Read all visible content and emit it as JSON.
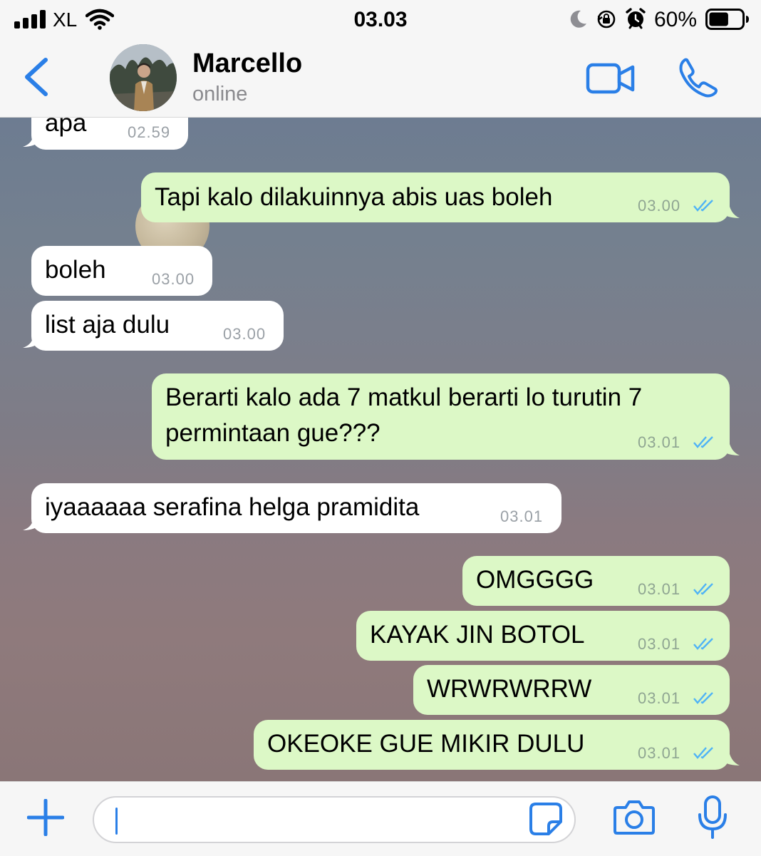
{
  "status_bar": {
    "carrier": "XL",
    "time": "03.03",
    "battery_percent": "60%",
    "battery_level": 0.6
  },
  "header": {
    "contact_name": "Marcello",
    "contact_status": "online"
  },
  "messages": [
    {
      "direction": "in",
      "text": "apa",
      "time": "02.59"
    },
    {
      "direction": "out",
      "text": "Tapi kalo dilakuinnya abis uas boleh",
      "time": "03.00",
      "status": "read"
    },
    {
      "direction": "in",
      "text": "boleh",
      "time": "03.00"
    },
    {
      "direction": "in",
      "text": "list aja dulu",
      "time": "03.00"
    },
    {
      "direction": "out",
      "text_line1": "Berarti kalo ada 7 matkul berarti lo turutin 7",
      "text_line2": "permintaan gue???",
      "time": "03.01",
      "status": "read"
    },
    {
      "direction": "in",
      "text": "iyaaaaaa serafina helga pramidita",
      "time": "03.01"
    },
    {
      "direction": "out",
      "text": "OMGGGG",
      "time": "03.01",
      "status": "read"
    },
    {
      "direction": "out",
      "text": "KAYAK JIN BOTOL",
      "time": "03.01",
      "status": "read"
    },
    {
      "direction": "out",
      "text": "WRWRWRRW",
      "time": "03.01",
      "status": "read"
    },
    {
      "direction": "out",
      "text": "OKEOKE GUE MIKIR DULU",
      "time": "03.01",
      "status": "read"
    }
  ],
  "input": {
    "placeholder": ""
  },
  "colors": {
    "accent": "#2a7fe7",
    "outgoing_bubble": "#dcf8c6",
    "incoming_bubble": "#ffffff",
    "read_ticks": "#4fb3f6"
  }
}
